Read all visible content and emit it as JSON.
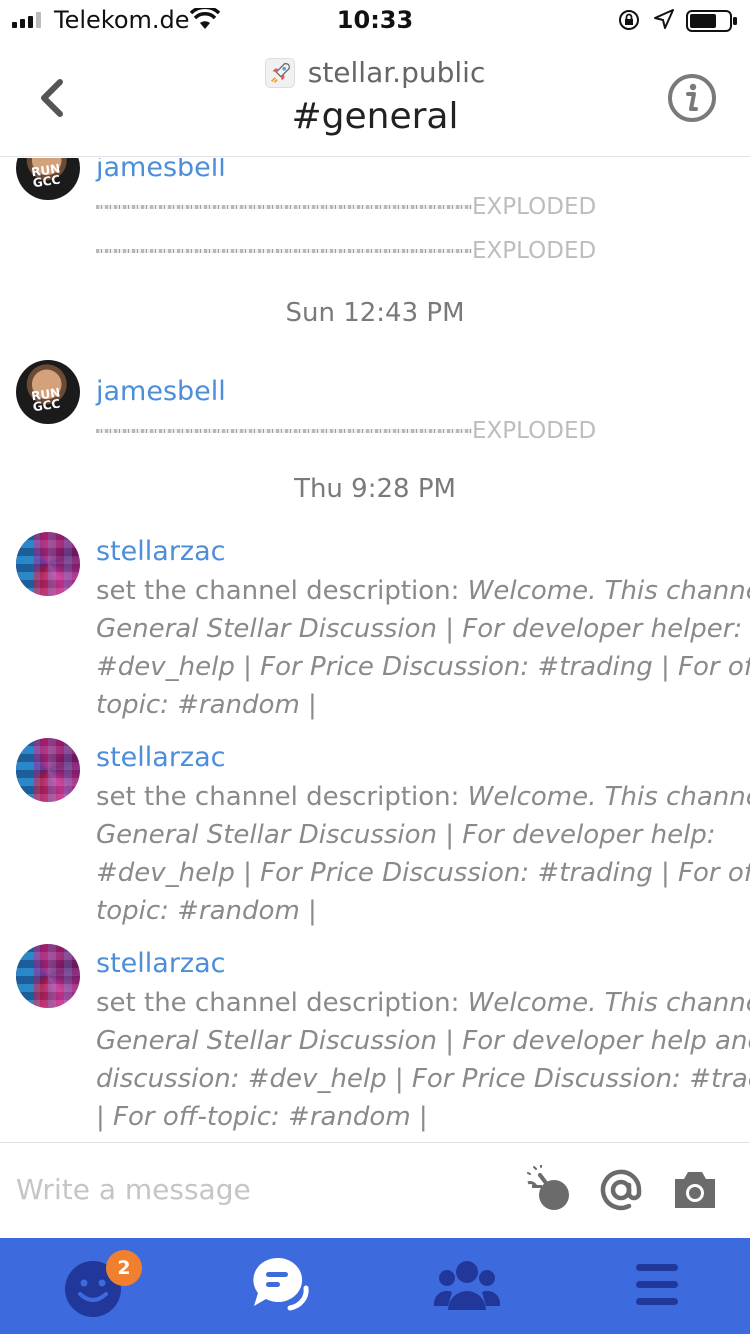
{
  "status_bar": {
    "carrier": "Telekom.de",
    "time": "10:33"
  },
  "header": {
    "team_name": "stellar.public",
    "channel_name": "#general"
  },
  "messages": [
    {
      "type": "exploding",
      "username": "jamesbell",
      "items": [
        "EXPLODED",
        "EXPLODED"
      ]
    },
    {
      "type": "divider",
      "text": "Sun 12:43 PM"
    },
    {
      "type": "exploding",
      "username": "jamesbell",
      "items": [
        "EXPLODED"
      ]
    },
    {
      "type": "divider",
      "text": "Thu 9:28 PM"
    },
    {
      "type": "system",
      "username": "stellarzac",
      "prefix": "set the channel description: ",
      "description": "Welcome. This channel for General Stellar Discussion | For developer helper: #dev_help | For Price Discussion: #trading | For off-topic: #random |"
    },
    {
      "type": "system",
      "username": "stellarzac",
      "prefix": "set the channel description: ",
      "description": "Welcome. This channel for General Stellar Discussion | For developer help: #dev_help | For Price Discussion: #trading | For off-topic: #random |"
    },
    {
      "type": "system",
      "username": "stellarzac",
      "prefix": "set the channel description: ",
      "description": "Welcome. This channel for General Stellar Discussion | For developer help and discussion: #dev_help | For Price Discussion: #trading | For off-topic: #random |"
    }
  ],
  "avatar_text": "RUN GCC",
  "composer": {
    "placeholder": "Write a message",
    "icons": [
      "exploding-bomb-icon",
      "mention-icon",
      "camera-icon"
    ]
  },
  "tabbar": {
    "tabs": [
      {
        "name": "people-tab",
        "icon": "smiley-icon",
        "badge": "2"
      },
      {
        "name": "chat-tab",
        "icon": "chat-bubbles-icon",
        "active": true
      },
      {
        "name": "teams-tab",
        "icon": "group-icon"
      },
      {
        "name": "menu-tab",
        "icon": "hamburger-icon"
      }
    ]
  },
  "colors": {
    "accent": "#4c8eda",
    "tabbar": "#3d6bdd",
    "badge": "#f0802e"
  }
}
